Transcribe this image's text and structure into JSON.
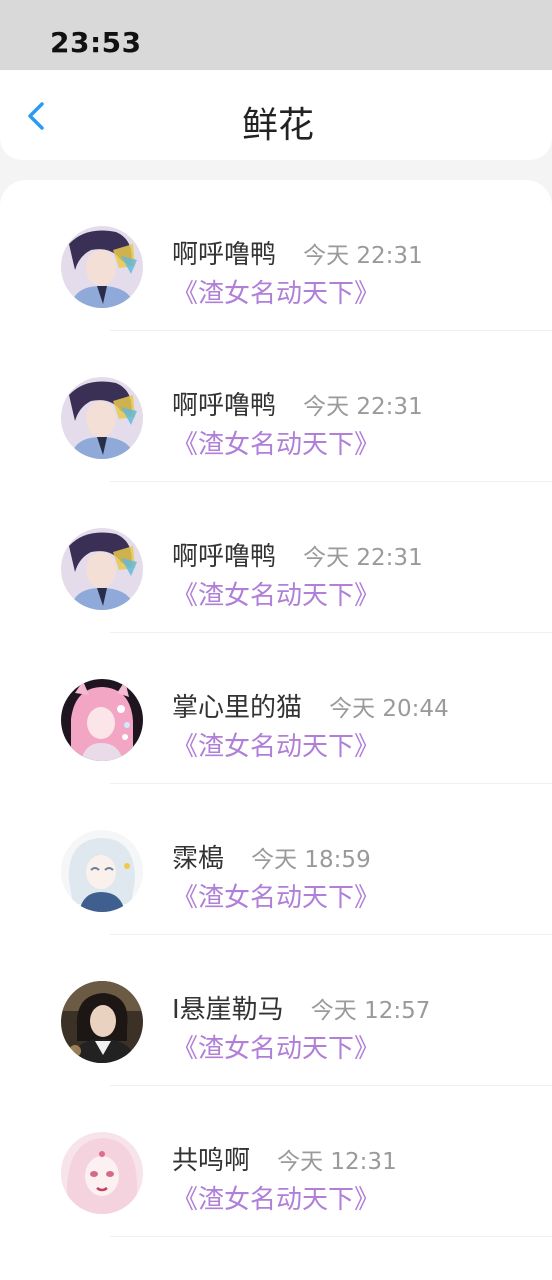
{
  "status_bar": {
    "time": "23:53"
  },
  "nav": {
    "title": "鲜花",
    "back_icon": "chevron-left-icon"
  },
  "colors": {
    "accent": "#2b9af3",
    "book_link": "#b07fd8",
    "time_text": "#9a9a9a"
  },
  "items": [
    {
      "name": "啊呼噜鸭",
      "time": "今天 22:31",
      "book": "《渣女名动天下》",
      "avatar": "avatar-boy-blue"
    },
    {
      "name": "啊呼噜鸭",
      "time": "今天 22:31",
      "book": "《渣女名动天下》",
      "avatar": "avatar-boy-blue"
    },
    {
      "name": "啊呼噜鸭",
      "time": "今天 22:31",
      "book": "《渣女名动天下》",
      "avatar": "avatar-boy-blue"
    },
    {
      "name": "掌心里的猫",
      "time": "今天 20:44",
      "book": "《渣女名动天下》",
      "avatar": "avatar-pink-girl"
    },
    {
      "name": "霂槝",
      "time": "今天 18:59",
      "book": "《渣女名动天下》",
      "avatar": "avatar-white-hair-girl"
    },
    {
      "name": "I悬崖勒马",
      "time": "今天 12:57",
      "book": "《渣女名动天下》",
      "avatar": "avatar-photo-girl"
    },
    {
      "name": "共鸣啊",
      "time": "今天 12:31",
      "book": "《渣女名动天下》",
      "avatar": "avatar-pale-girl"
    }
  ]
}
